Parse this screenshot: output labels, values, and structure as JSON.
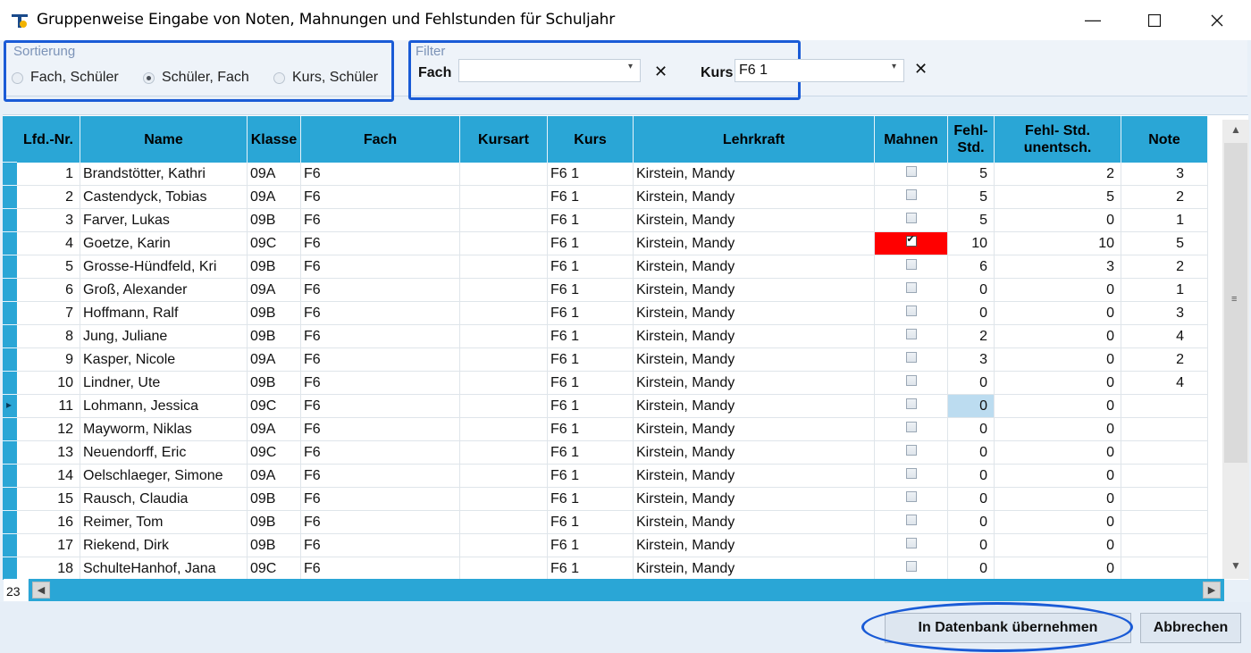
{
  "window": {
    "title": "Gruppenweise Eingabe von Noten, Mahnungen und Fehlstunden für Schuljahr"
  },
  "sort": {
    "legend": "Sortierung",
    "options": [
      {
        "label": "Fach, Schüler",
        "selected": false
      },
      {
        "label": "Schüler, Fach",
        "selected": true
      },
      {
        "label": "Kurs, Schüler",
        "selected": false
      }
    ]
  },
  "filter": {
    "legend": "Filter",
    "fach_label": "Fach",
    "fach_value": "",
    "kurs_label": "Kurs",
    "kurs_value": "F6 1"
  },
  "grid": {
    "columns": [
      "Lfd.-Nr.",
      "Name",
      "Klasse",
      "Fach",
      "Kursart",
      "Kurs",
      "Lehrkraft",
      "Mahnen",
      "Fehl-\nStd.",
      "Fehl- Std.\nunentsch.",
      "Note"
    ],
    "rows": [
      {
        "nr": "1",
        "name": "Brandstötter, Kathri",
        "klasse": "09A",
        "fach": "F6",
        "kursart": "",
        "kurs": "F6 1",
        "lehrkraft": "Kirstein, Mandy",
        "mahnen": false,
        "fehl": "5",
        "unent": "2",
        "note": "3"
      },
      {
        "nr": "2",
        "name": "Castendyck, Tobias",
        "klasse": "09A",
        "fach": "F6",
        "kursart": "",
        "kurs": "F6 1",
        "lehrkraft": "Kirstein, Mandy",
        "mahnen": false,
        "fehl": "5",
        "unent": "5",
        "note": "2"
      },
      {
        "nr": "3",
        "name": "Farver, Lukas",
        "klasse": "09B",
        "fach": "F6",
        "kursart": "",
        "kurs": "F6 1",
        "lehrkraft": "Kirstein, Mandy",
        "mahnen": false,
        "fehl": "5",
        "unent": "0",
        "note": "1"
      },
      {
        "nr": "4",
        "name": "Goetze, Karin",
        "klasse": "09C",
        "fach": "F6",
        "kursart": "",
        "kurs": "F6 1",
        "lehrkraft": "Kirstein, Mandy",
        "mahnen": true,
        "fehl": "10",
        "unent": "10",
        "note": "5"
      },
      {
        "nr": "5",
        "name": "Grosse-Hündfeld, Kri",
        "klasse": "09B",
        "fach": "F6",
        "kursart": "",
        "kurs": "F6 1",
        "lehrkraft": "Kirstein, Mandy",
        "mahnen": false,
        "fehl": "6",
        "unent": "3",
        "note": "2"
      },
      {
        "nr": "6",
        "name": "Groß, Alexander",
        "klasse": "09A",
        "fach": "F6",
        "kursart": "",
        "kurs": "F6 1",
        "lehrkraft": "Kirstein, Mandy",
        "mahnen": false,
        "fehl": "0",
        "unent": "0",
        "note": "1"
      },
      {
        "nr": "7",
        "name": "Hoffmann, Ralf",
        "klasse": "09B",
        "fach": "F6",
        "kursart": "",
        "kurs": "F6 1",
        "lehrkraft": "Kirstein, Mandy",
        "mahnen": false,
        "fehl": "0",
        "unent": "0",
        "note": "3"
      },
      {
        "nr": "8",
        "name": "Jung, Juliane",
        "klasse": "09B",
        "fach": "F6",
        "kursart": "",
        "kurs": "F6 1",
        "lehrkraft": "Kirstein, Mandy",
        "mahnen": false,
        "fehl": "2",
        "unent": "0",
        "note": "4"
      },
      {
        "nr": "9",
        "name": "Kasper, Nicole",
        "klasse": "09A",
        "fach": "F6",
        "kursart": "",
        "kurs": "F6 1",
        "lehrkraft": "Kirstein, Mandy",
        "mahnen": false,
        "fehl": "3",
        "unent": "0",
        "note": "2"
      },
      {
        "nr": "10",
        "name": "Lindner, Ute",
        "klasse": "09B",
        "fach": "F6",
        "kursart": "",
        "kurs": "F6 1",
        "lehrkraft": "Kirstein, Mandy",
        "mahnen": false,
        "fehl": "0",
        "unent": "0",
        "note": "4"
      },
      {
        "nr": "11",
        "name": "Lohmann, Jessica",
        "klasse": "09C",
        "fach": "F6",
        "kursart": "",
        "kurs": "F6 1",
        "lehrkraft": "Kirstein, Mandy",
        "mahnen": false,
        "fehl": "0",
        "unent": "0",
        "note": "",
        "current": true
      },
      {
        "nr": "12",
        "name": "Mayworm, Niklas",
        "klasse": "09A",
        "fach": "F6",
        "kursart": "",
        "kurs": "F6 1",
        "lehrkraft": "Kirstein, Mandy",
        "mahnen": false,
        "fehl": "0",
        "unent": "0",
        "note": ""
      },
      {
        "nr": "13",
        "name": "Neuendorff, Eric",
        "klasse": "09C",
        "fach": "F6",
        "kursart": "",
        "kurs": "F6 1",
        "lehrkraft": "Kirstein, Mandy",
        "mahnen": false,
        "fehl": "0",
        "unent": "0",
        "note": ""
      },
      {
        "nr": "14",
        "name": "Oelschlaeger, Simone",
        "klasse": "09A",
        "fach": "F6",
        "kursart": "",
        "kurs": "F6 1",
        "lehrkraft": "Kirstein, Mandy",
        "mahnen": false,
        "fehl": "0",
        "unent": "0",
        "note": ""
      },
      {
        "nr": "15",
        "name": "Rausch, Claudia",
        "klasse": "09B",
        "fach": "F6",
        "kursart": "",
        "kurs": "F6 1",
        "lehrkraft": "Kirstein, Mandy",
        "mahnen": false,
        "fehl": "0",
        "unent": "0",
        "note": ""
      },
      {
        "nr": "16",
        "name": "Reimer, Tom",
        "klasse": "09B",
        "fach": "F6",
        "kursart": "",
        "kurs": "F6 1",
        "lehrkraft": "Kirstein, Mandy",
        "mahnen": false,
        "fehl": "0",
        "unent": "0",
        "note": ""
      },
      {
        "nr": "17",
        "name": "Riekend, Dirk",
        "klasse": "09B",
        "fach": "F6",
        "kursart": "",
        "kurs": "F6 1",
        "lehrkraft": "Kirstein, Mandy",
        "mahnen": false,
        "fehl": "0",
        "unent": "0",
        "note": ""
      },
      {
        "nr": "18",
        "name": "SchulteHanhof, Jana",
        "klasse": "09C",
        "fach": "F6",
        "kursart": "",
        "kurs": "F6 1",
        "lehrkraft": "Kirstein, Mandy",
        "mahnen": false,
        "fehl": "0",
        "unent": "0",
        "note": ""
      }
    ],
    "record_count": "23"
  },
  "buttons": {
    "apply": "In Datenbank übernehmen",
    "cancel": "Abbrechen"
  },
  "colors": {
    "accent": "#2aa6d6",
    "warning": "#ff0000",
    "highlight": "#1a5bd6"
  }
}
